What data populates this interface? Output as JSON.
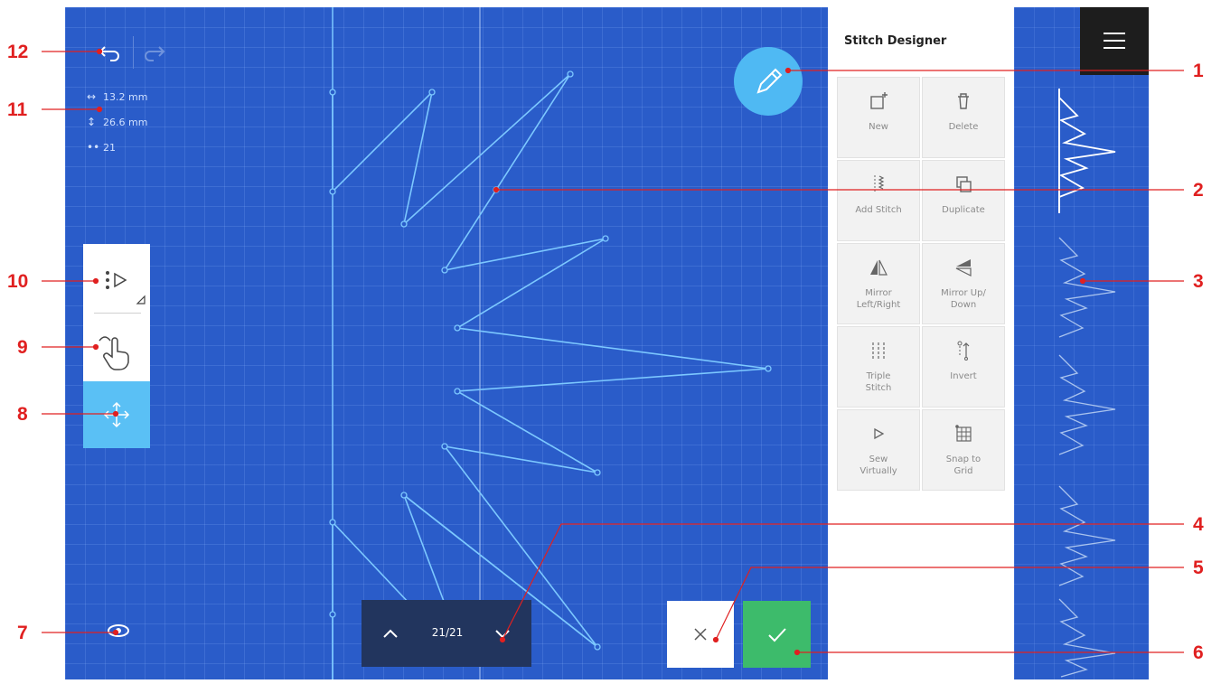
{
  "panel": {
    "title": "Stitch Designer",
    "tools": [
      {
        "label": "New",
        "icon": "new-icon"
      },
      {
        "label": "Delete",
        "icon": "trash-icon"
      },
      {
        "label": "Add Stitch",
        "icon": "add-stitch-icon"
      },
      {
        "label": "Duplicate",
        "icon": "duplicate-icon"
      },
      {
        "label": "Mirror\nLeft/Right",
        "icon": "mirror-left-right-icon"
      },
      {
        "label": "Mirror Up/\nDown",
        "icon": "mirror-up-down-icon"
      },
      {
        "label": "Triple\nStitch",
        "icon": "triple-stitch-icon"
      },
      {
        "label": "Invert",
        "icon": "invert-icon"
      },
      {
        "label": "Sew\nVirtually",
        "icon": "play-icon"
      },
      {
        "label": "Snap to\nGrid",
        "icon": "grid-icon"
      }
    ]
  },
  "measurements": {
    "width": "13.2 mm",
    "height": "26.6 mm",
    "stitch_count": "21"
  },
  "pager": {
    "label": "21/21"
  },
  "callouts": [
    "1",
    "2",
    "3",
    "4",
    "5",
    "6",
    "7",
    "8",
    "9",
    "10",
    "11",
    "12"
  ],
  "colors": {
    "canvas": "#2a5cc9",
    "stitch_line": "#7cc8ff",
    "fab": "#4fb9f3",
    "confirm": "#3dbb6b",
    "pager": "#22355e",
    "callout": "#e02020",
    "menu": "#1d1d1d"
  }
}
